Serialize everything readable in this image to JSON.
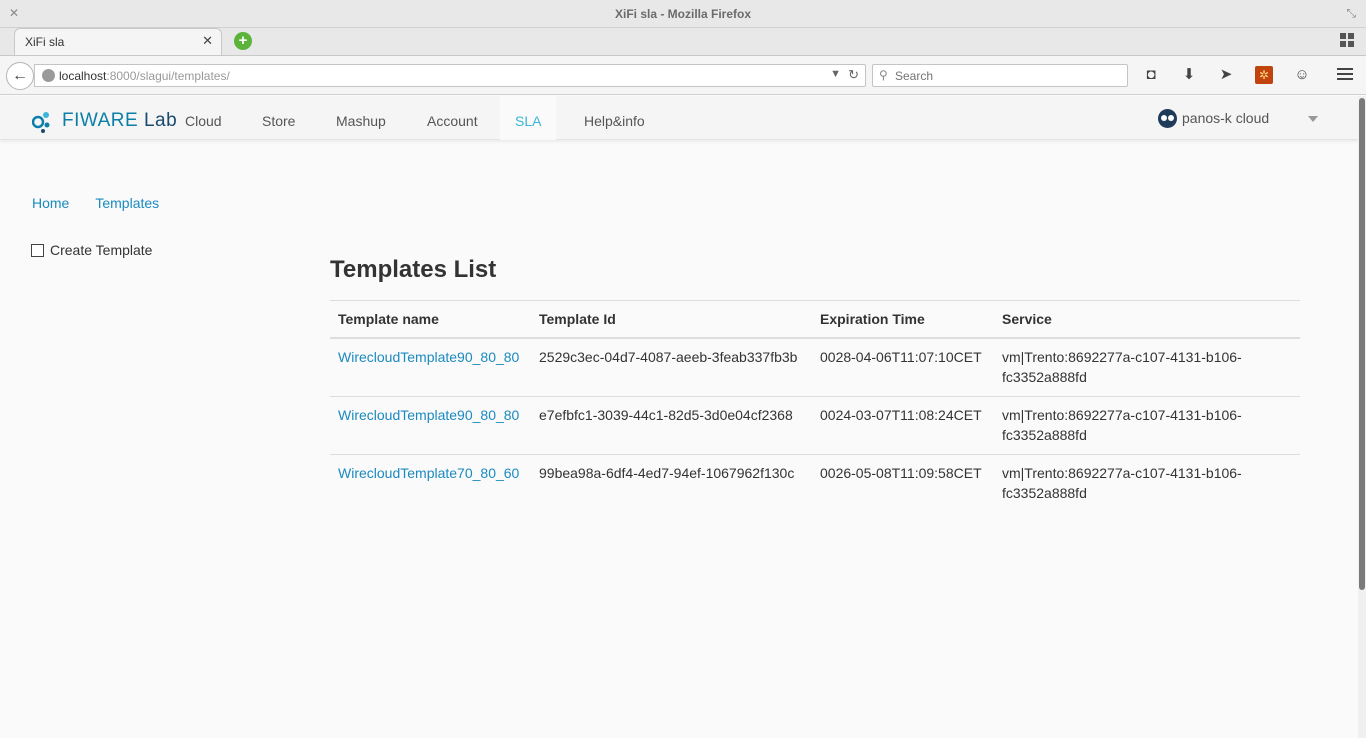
{
  "browser": {
    "window_title": "XiFi sla - Mozilla Firefox",
    "tab_title": "XiFi sla",
    "url_host": "localhost",
    "url_rest": ":8000/slagui/templates/",
    "search_placeholder": "Search"
  },
  "header": {
    "logo_fi": "FIWARE",
    "logo_lab": "Lab",
    "nav": [
      "Cloud",
      "Store",
      "Mashup",
      "Account",
      "SLA",
      "Help&info"
    ],
    "active_nav": "SLA",
    "user": "panos-k cloud"
  },
  "breadcrumb": {
    "home": "Home",
    "templates": "Templates"
  },
  "sidebar": {
    "create_template": "Create Template"
  },
  "main": {
    "title": "Templates List",
    "columns": [
      "Template name",
      "Template Id",
      "Expiration Time",
      "Service"
    ],
    "rows": [
      {
        "name": "WirecloudTemplate90_80_80",
        "id": "2529c3ec-04d7-4087-aeeb-3feab337fb3b",
        "expiration": "0028-04-06T11:07:10CET",
        "service": "vm|Trento:8692277a-c107-4131-b106-fc3352a888fd"
      },
      {
        "name": "WirecloudTemplate90_80_80",
        "id": "e7efbfc1-3039-44c1-82d5-3d0e04cf2368",
        "expiration": "0024-03-07T11:08:24CET",
        "service": "vm|Trento:8692277a-c107-4131-b106-fc3352a888fd"
      },
      {
        "name": "WirecloudTemplate70_80_60",
        "id": "99bea98a-6df4-4ed7-94ef-1067962f130c",
        "expiration": "0026-05-08T11:09:58CET",
        "service": "vm|Trento:8692277a-c107-4131-b106-fc3352a888fd"
      }
    ]
  },
  "colors": {
    "link": "#1a8ac0",
    "active_nav": "#3ab6d8",
    "logo": "#0b7fa7"
  }
}
